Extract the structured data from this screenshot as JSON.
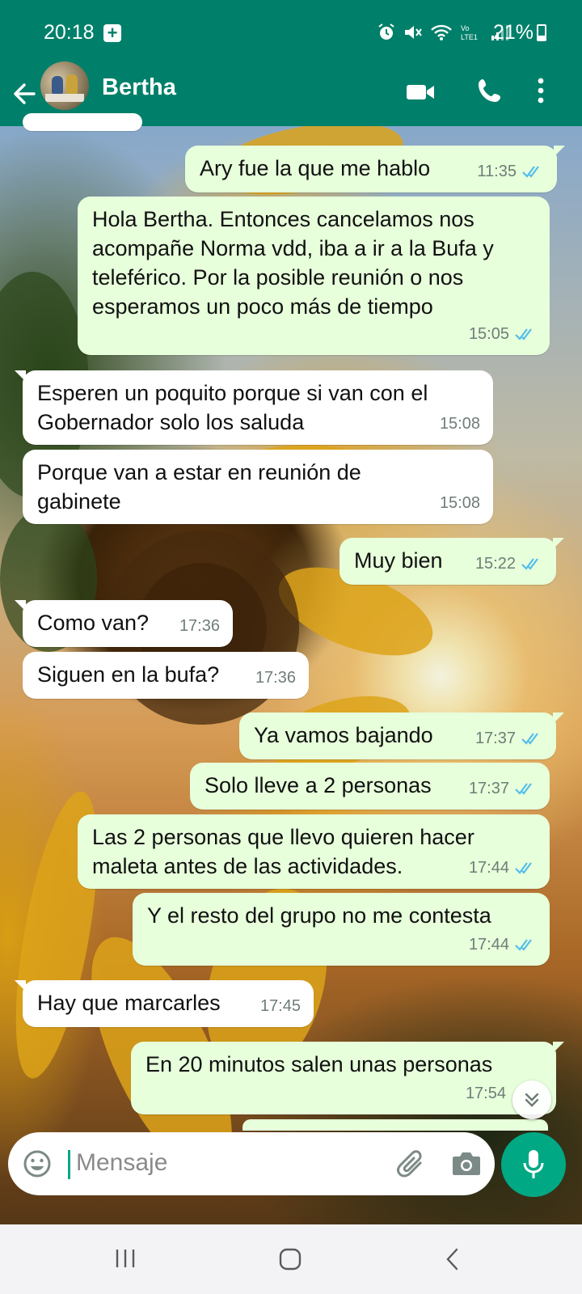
{
  "status_bar": {
    "time": "20:18",
    "battery": "21%",
    "icons": [
      "plus-notification-icon",
      "alarm-icon",
      "mute-icon",
      "wifi-icon",
      "volte-icon",
      "signal-icon",
      "battery-icon"
    ]
  },
  "header": {
    "contact_name": "Bertha",
    "icons": [
      "back-arrow-icon",
      "avatar",
      "video-call-icon",
      "phone-icon",
      "more-options-icon"
    ]
  },
  "messages": [
    {
      "dir": "out",
      "text": "Ary fue la que me hablo",
      "time": "11:35",
      "read": true
    },
    {
      "dir": "out",
      "text": "Hola Bertha. Entonces cancelamos nos acompañe Norma vdd, iba a ir a la Bufa y teleférico. Por la posible reunión o nos esperamos un poco más  de tiempo",
      "time": "15:05",
      "read": true
    },
    {
      "dir": "in",
      "text": "Esperen un poquito porque si van con el Gobernador solo los saluda",
      "time": "15:08"
    },
    {
      "dir": "in",
      "text": "Porque van a estar en reunión de gabinete",
      "time": "15:08"
    },
    {
      "dir": "out",
      "text": "Muy bien",
      "time": "15:22",
      "read": true
    },
    {
      "dir": "in",
      "text": "Como van?",
      "time": "17:36"
    },
    {
      "dir": "in",
      "text": "Siguen en la bufa?",
      "time": "17:36"
    },
    {
      "dir": "out",
      "text": "Ya vamos bajando",
      "time": "17:37",
      "read": true
    },
    {
      "dir": "out",
      "text": "Solo lleve a 2 personas",
      "time": "17:37",
      "read": true
    },
    {
      "dir": "out",
      "text": "Las 2 personas que llevo quieren hacer maleta antes de las actividades.",
      "time": "17:44",
      "read": true
    },
    {
      "dir": "out",
      "text": "Y el resto del grupo  no me contesta",
      "time": "17:44",
      "read": true
    },
    {
      "dir": "in",
      "text": "Hay que marcarles",
      "time": "17:45"
    },
    {
      "dir": "out",
      "text": "En 20 minutos  salen unas personas",
      "time": "17:54",
      "read": false
    }
  ],
  "composer": {
    "placeholder": "Mensaje",
    "icons": [
      "emoji-icon",
      "attach-icon",
      "camera-icon",
      "mic-icon"
    ]
  },
  "colors": {
    "header": "#00806a",
    "outgoing_bubble": "#e7ffdb",
    "incoming_bubble": "#ffffff",
    "read_ticks": "#53bdeb",
    "accent": "#00a884"
  }
}
